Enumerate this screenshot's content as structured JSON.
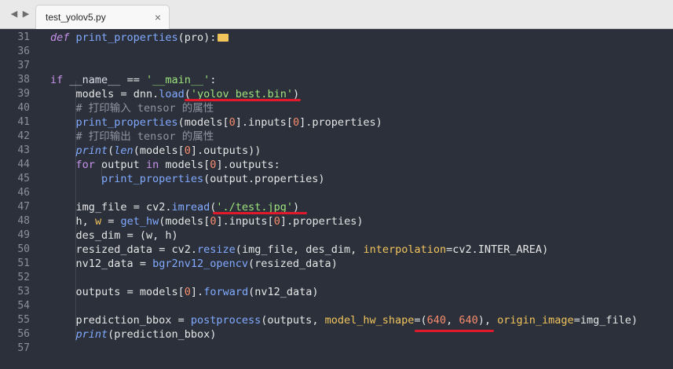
{
  "tab": {
    "title": "test_yolov5.py",
    "close": "×"
  },
  "nav": {
    "left": "◀",
    "right": "▶"
  },
  "code_lines": [
    {
      "n": "31",
      "text": "def print_properties(pro):"
    },
    {
      "n": "36",
      "text": ""
    },
    {
      "n": "37",
      "text": ""
    },
    {
      "n": "38",
      "text": "if __name__ == '__main__':"
    },
    {
      "n": "39",
      "text": "    models = dnn.load('yolov_best.bin')"
    },
    {
      "n": "40",
      "text": "    # 打印输入 tensor 的属性"
    },
    {
      "n": "41",
      "text": "    print_properties(models[0].inputs[0].properties)"
    },
    {
      "n": "42",
      "text": "    # 打印输出 tensor 的属性"
    },
    {
      "n": "43",
      "text": "    print(len(models[0].outputs))"
    },
    {
      "n": "44",
      "text": "    for output in models[0].outputs:"
    },
    {
      "n": "45",
      "text": "        print_properties(output.properties)"
    },
    {
      "n": "46",
      "text": ""
    },
    {
      "n": "47",
      "text": "    img_file = cv2.imread('./test.jpg')"
    },
    {
      "n": "48",
      "text": "    h, w = get_hw(models[0].inputs[0].properties)"
    },
    {
      "n": "49",
      "text": "    des_dim = (w, h)"
    },
    {
      "n": "50",
      "text": "    resized_data = cv2.resize(img_file, des_dim, interpolation=cv2.INTER_AREA)"
    },
    {
      "n": "51",
      "text": "    nv12_data = bgr2nv12_opencv(resized_data)"
    },
    {
      "n": "52",
      "text": ""
    },
    {
      "n": "53",
      "text": "    outputs = models[0].forward(nv12_data)"
    },
    {
      "n": "54",
      "text": ""
    },
    {
      "n": "55",
      "text": "    prediction_bbox = postprocess(outputs, model_hw_shape=(640, 640), origin_image=img_file)"
    },
    {
      "n": "56",
      "text": "    print(prediction_bbox)"
    },
    {
      "n": "57",
      "text": ""
    }
  ],
  "colors": {
    "background": "#2b303b",
    "keyword": "#c792ea",
    "function": "#82aaff",
    "string": "#9ee37d",
    "number": "#f78c6c",
    "comment": "#8f96a3",
    "param": "#f2c45c",
    "annotation": "#e0192c"
  }
}
